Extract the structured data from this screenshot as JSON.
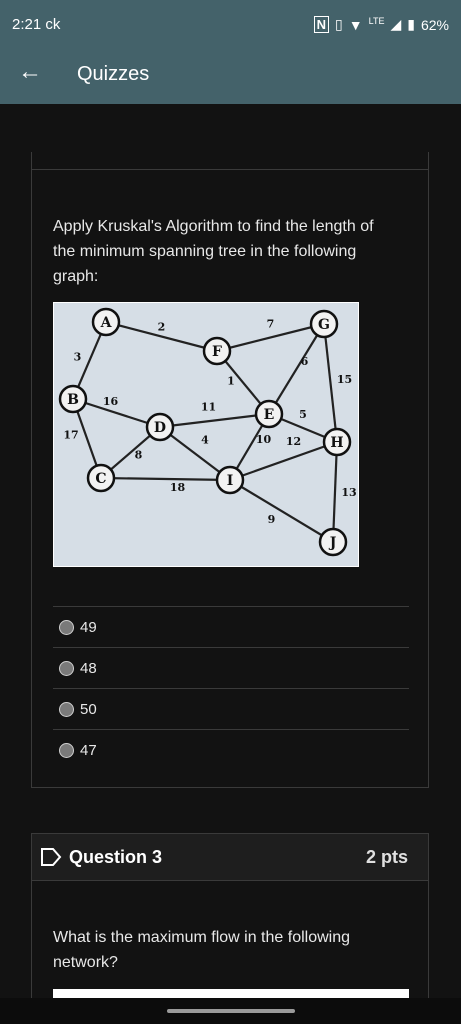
{
  "status": {
    "time": "2:21",
    "carrier": "ck",
    "network": "LTE",
    "battery": "62%"
  },
  "appbar": {
    "title": "Quizzes"
  },
  "question2": {
    "prompt": "Apply Kruskal's Algorithm  to find the length of the minimum spanning tree in the following graph:",
    "graph": {
      "nodes": [
        {
          "id": "A"
        },
        {
          "id": "B"
        },
        {
          "id": "C"
        },
        {
          "id": "D"
        },
        {
          "id": "F"
        },
        {
          "id": "G"
        },
        {
          "id": "E"
        },
        {
          "id": "H"
        },
        {
          "id": "I"
        },
        {
          "id": "J"
        }
      ],
      "edges": [
        {
          "from": "A",
          "to": "F",
          "w": "2"
        },
        {
          "from": "A",
          "to": "B",
          "w": "3"
        },
        {
          "from": "F",
          "to": "G",
          "w": "7"
        },
        {
          "from": "F",
          "to": "E",
          "w": "1"
        },
        {
          "from": "G",
          "to": "E",
          "w": "6"
        },
        {
          "from": "G",
          "to": "H",
          "w": "15"
        },
        {
          "from": "B",
          "to": "D",
          "w": "16"
        },
        {
          "from": "B",
          "to": "C",
          "w": "17"
        },
        {
          "from": "D",
          "to": "E",
          "w": "11"
        },
        {
          "from": "D",
          "to": "I",
          "w": "4"
        },
        {
          "from": "C",
          "to": "D",
          "w": "8"
        },
        {
          "from": "C",
          "to": "I",
          "w": "18"
        },
        {
          "from": "E",
          "to": "H",
          "w": "5"
        },
        {
          "from": "E",
          "to": "I",
          "w": "10"
        },
        {
          "from": "I",
          "to": "H",
          "w": "12"
        },
        {
          "from": "I",
          "to": "J",
          "w": "9"
        },
        {
          "from": "H",
          "to": "J",
          "w": "13"
        }
      ]
    },
    "answers": [
      "49",
      "48",
      "50",
      "47"
    ]
  },
  "question3": {
    "title": "Question 3",
    "points": "2 pts",
    "prompt": "What is the maximum flow in the following network?"
  }
}
